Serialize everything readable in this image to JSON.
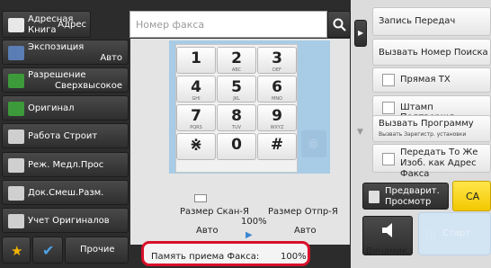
{
  "top": {
    "address_book_label": "Адресная Книга",
    "address_label": "Адрес",
    "fax_placeholder": "Номер факса"
  },
  "left_menu": {
    "exposure": {
      "label": "Экспозиция",
      "value": "Авто"
    },
    "resolution": {
      "label": "Разрешение",
      "value": "Сверхвысокое"
    },
    "original": {
      "label": "Оригинал"
    },
    "job_build": {
      "label": "Работа Строит"
    },
    "slow_scan": {
      "label": "Реж. Медл.Прос"
    },
    "mixed_size": {
      "label": "Док.Смеш.Разм."
    },
    "original_count": {
      "label": "Учет Оригиналов"
    },
    "others": {
      "label": "Прочие"
    }
  },
  "keypad": {
    "keys": [
      {
        "n": "1",
        "s": ""
      },
      {
        "n": "2",
        "s": "ABC"
      },
      {
        "n": "3",
        "s": "DEF"
      },
      {
        "n": "4",
        "s": "GHI"
      },
      {
        "n": "5",
        "s": "JKL"
      },
      {
        "n": "6",
        "s": "MNO"
      },
      {
        "n": "7",
        "s": "PQRS"
      },
      {
        "n": "8",
        "s": "TUV"
      },
      {
        "n": "9",
        "s": "WXYZ"
      },
      {
        "n": "⋇",
        "s": ""
      },
      {
        "n": "0",
        "s": ""
      },
      {
        "n": "#",
        "s": ""
      }
    ]
  },
  "scan_info": {
    "scan_size_label": "Размер Скан-Я",
    "scan_size_value": "Авто",
    "ratio": "100%",
    "send_size_label": "Размер Отпр-Я",
    "send_size_value": "Авто"
  },
  "status": {
    "fax_memory_label": "Память приема Факса:",
    "fax_memory_value": "100%"
  },
  "right_panel": {
    "send_record": "Запись Передач",
    "call_search": "Вызвать Номер Поиска",
    "direct_tx": "Прямая TX",
    "stamp": "Штамп Подтвержд.",
    "call_program": "Вызвать Программу",
    "call_program_sub": "Вызвать Зарегистр. установки",
    "same_image": "Передать То Же Изоб. как Адрес Факса",
    "preview": "Предварит. Просмотр",
    "ca": "CA",
    "speaker": "Динамик",
    "start": "Старт"
  },
  "colors": {
    "accent_yellow": "#f5d000",
    "highlight_red": "#d9102a",
    "icon_blue": "#3d86d0",
    "icon_green": "#3d9a3a"
  }
}
